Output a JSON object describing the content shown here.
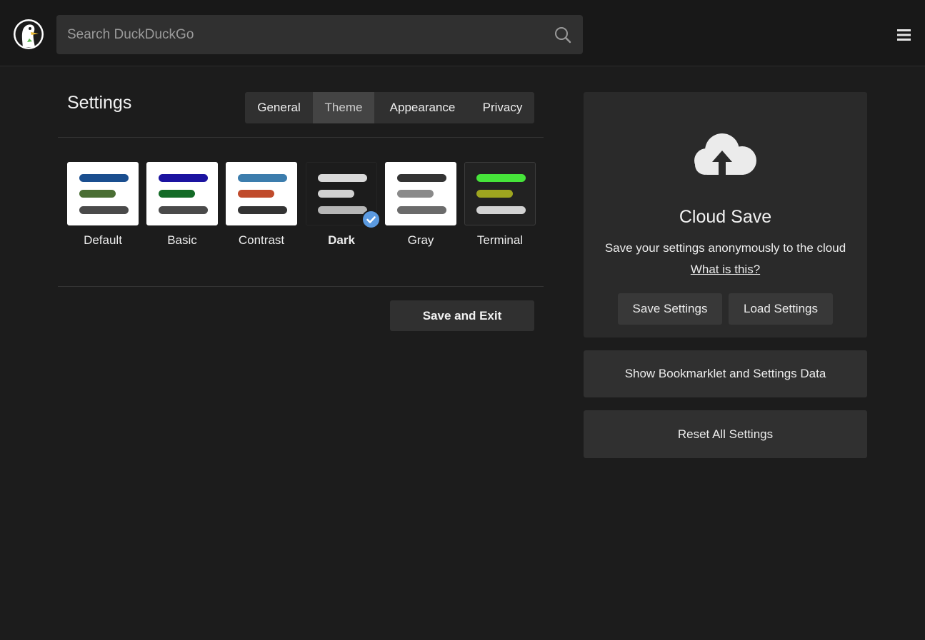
{
  "header": {
    "search_placeholder": "Search DuckDuckGo",
    "logo_icon": "duckduckgo-logo-icon",
    "search_icon": "search-icon",
    "menu_icon": "hamburger-menu-icon"
  },
  "settings": {
    "title": "Settings",
    "tabs": [
      {
        "label": "General",
        "active": false
      },
      {
        "label": "Theme",
        "active": true
      },
      {
        "label": "Appearance",
        "active": false
      },
      {
        "label": "Privacy",
        "active": false
      }
    ],
    "themes": [
      {
        "label": "Default",
        "bg": "#ffffff",
        "border": "#ffffff",
        "bars": [
          "#1a4e8f",
          "#4a6e34",
          "#4a4a4a"
        ],
        "selected": false
      },
      {
        "label": "Basic",
        "bg": "#ffffff",
        "border": "#ffffff",
        "bars": [
          "#1b13a0",
          "#136a26",
          "#4a4a4a"
        ],
        "selected": false
      },
      {
        "label": "Contrast",
        "bg": "#ffffff",
        "border": "#ffffff",
        "bars": [
          "#3c7dad",
          "#c04b2c",
          "#333333"
        ],
        "selected": false
      },
      {
        "label": "Dark",
        "bg": "#1c1c1c",
        "border": "#252525",
        "bars": [
          "#d9d9d9",
          "#d2d2d2",
          "#b6b6b6"
        ],
        "selected": true
      },
      {
        "label": "Gray",
        "bg": "#ffffff",
        "border": "#ffffff",
        "bars": [
          "#333333",
          "#8a8a8a",
          "#6b6b6b"
        ],
        "selected": false
      },
      {
        "label": "Terminal",
        "bg": "#222222",
        "border": "#3c3c3c",
        "bars": [
          "#46e43a",
          "#9ea51f",
          "#d2d2d2"
        ],
        "selected": false
      }
    ],
    "save_exit_label": "Save and Exit"
  },
  "cloud": {
    "icon": "cloud-upload-icon",
    "title": "Cloud Save",
    "description": "Save your settings anonymously to the cloud",
    "link": "What is this?",
    "save_label": "Save Settings",
    "load_label": "Load Settings"
  },
  "actions": {
    "bookmarklet_label": "Show Bookmarklet and Settings Data",
    "reset_label": "Reset All Settings"
  },
  "colors": {
    "background": "#1c1c1c",
    "header": "#181818",
    "card": "#2a2a2a",
    "button": "#303030",
    "accent": "#5b9ae0"
  }
}
